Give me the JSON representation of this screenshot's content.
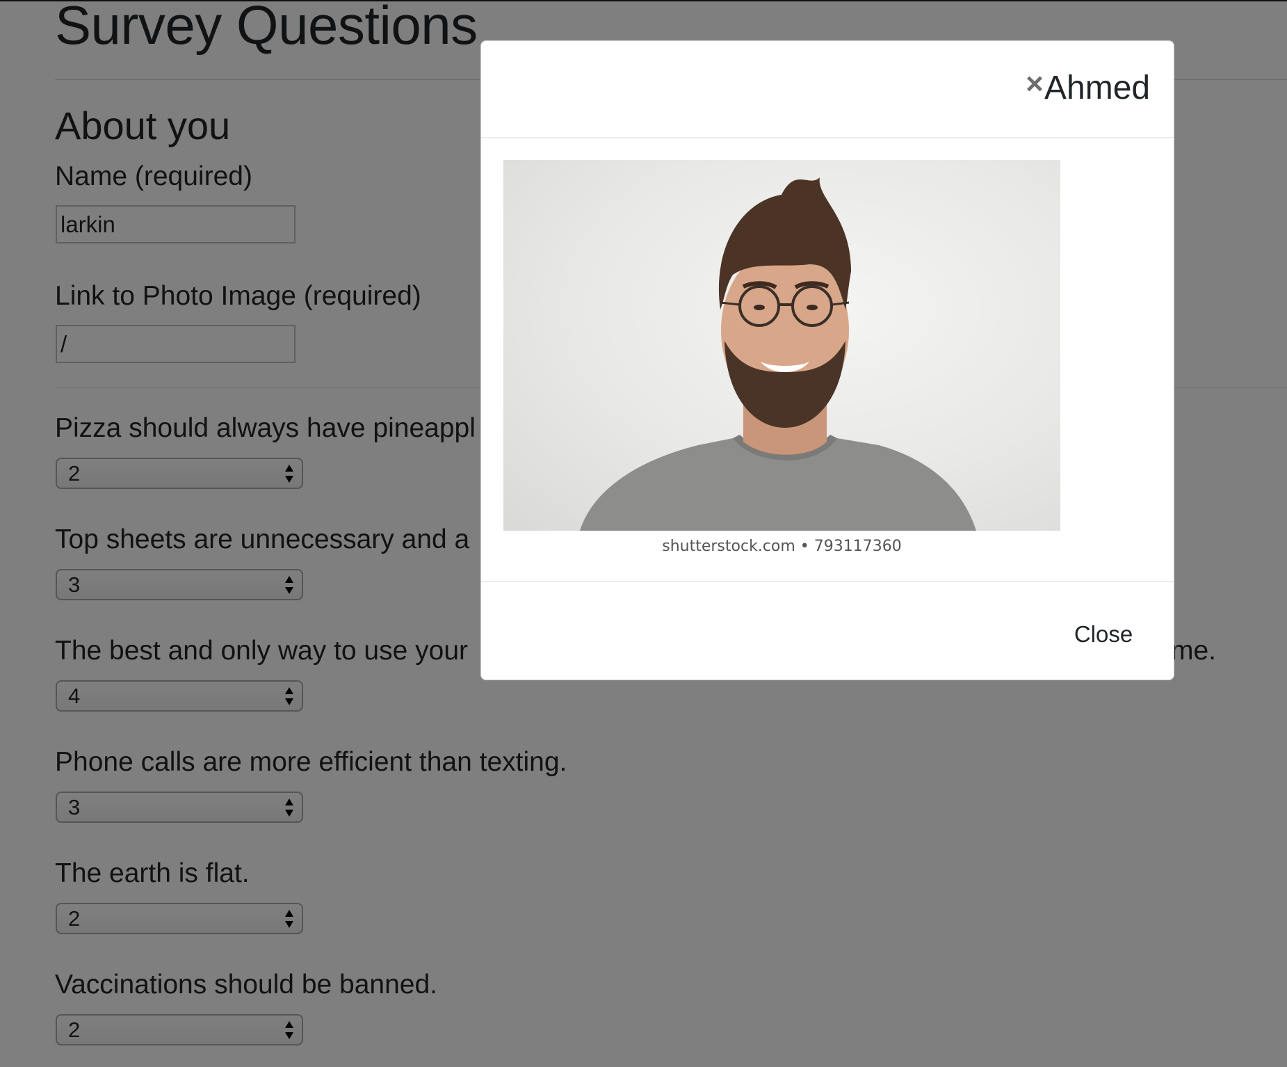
{
  "page": {
    "title": "Survey Questions",
    "section_title": "About you"
  },
  "form": {
    "name": {
      "label": "Name (required)",
      "value": "larkin"
    },
    "photo_link": {
      "label": "Link to Photo Image (required)",
      "value": "/"
    },
    "questions": [
      {
        "label": "Pizza should always have pineappl",
        "value": "2"
      },
      {
        "label": "Top sheets are unnecessary and a",
        "value": "3"
      },
      {
        "label": "The best and only way to use your",
        "label_tail": "me.",
        "value": "4"
      },
      {
        "label": "Phone calls are more efficient than texting.",
        "value": "3"
      },
      {
        "label": "The earth is flat.",
        "value": "2"
      },
      {
        "label": "Vaccinations should be banned.",
        "value": "2"
      }
    ]
  },
  "modal": {
    "title": "Ahmed",
    "close_icon": "×",
    "image_credit": "shutterstock.com • 793117360",
    "close_label": "Close"
  },
  "colors": {
    "backdrop": "rgba(0,0,0,0.5)",
    "modal_bg": "#ffffff",
    "text": "#212529"
  }
}
